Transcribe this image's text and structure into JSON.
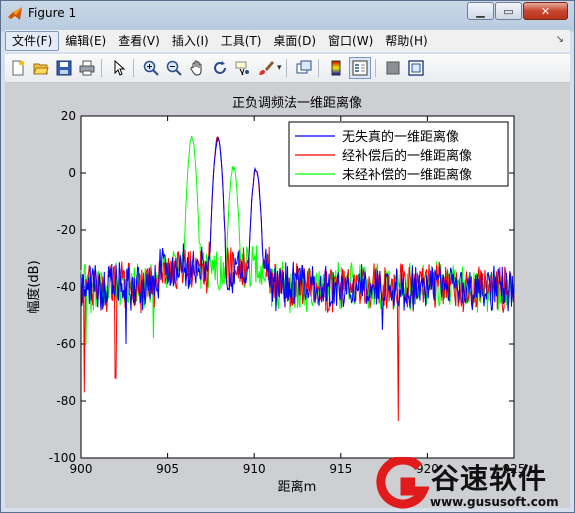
{
  "window": {
    "title": "Figure 1"
  },
  "menubar": {
    "items": [
      "文件(F)",
      "编辑(E)",
      "查看(V)",
      "插入(I)",
      "工具(T)",
      "桌面(D)",
      "窗口(W)",
      "帮助(H)"
    ],
    "active_index": 0
  },
  "toolbar": {
    "icons": [
      "new-figure-icon",
      "open-file-icon",
      "save-icon",
      "print-icon",
      "|",
      "pointer-icon",
      "|",
      "zoom-in-icon",
      "zoom-out-icon",
      "pan-hand-icon",
      "rotate-3d-icon",
      "data-cursor-icon",
      "brush-icon",
      "|",
      "link-plot-icon",
      "|",
      "colorbar-icon",
      "legend-icon",
      "|",
      "hide-plot-tools-icon",
      "show-plot-tools-icon"
    ]
  },
  "chart_data": {
    "type": "line",
    "title": "正负调频法一维距离像",
    "xlabel": "距离m",
    "ylabel": "幅度(dB)",
    "xlim": [
      900,
      925
    ],
    "ylim": [
      -100,
      20
    ],
    "xticks": [
      "900",
      "905",
      "910",
      "915",
      "920",
      "925"
    ],
    "yticks": [
      "20",
      "0",
      "-20",
      "-40",
      "-60",
      "-80",
      "-100"
    ],
    "legend_position": "top-right",
    "series": [
      {
        "name": "无失真的一维距离像",
        "color": "#0000ff",
        "peaks": [
          [
            907.9,
            12
          ],
          [
            910.1,
            1.5
          ]
        ],
        "noise_floor": -40,
        "notable_dips": [
          [
            902.6,
            -60
          ],
          [
            917.4,
            -55
          ]
        ]
      },
      {
        "name": "经补偿后的一维距离像",
        "color": "#ff0000",
        "peaks": [
          [
            907.9,
            12
          ],
          [
            910.1,
            1.5
          ]
        ],
        "noise_floor": -40,
        "notable_dips": [
          [
            900.2,
            -77
          ],
          [
            902.0,
            -72
          ],
          [
            918.3,
            -87
          ]
        ]
      },
      {
        "name": "未经补偿的一维距离像",
        "color": "#00ff00",
        "peaks": [
          [
            906.4,
            12
          ],
          [
            908.8,
            2
          ]
        ],
        "noise_floor": -40,
        "notable_dips": [
          [
            900.3,
            -60
          ],
          [
            904.2,
            -58
          ]
        ]
      }
    ]
  },
  "watermark": {
    "name": "谷速软件",
    "url": "www.gususoft.com"
  }
}
